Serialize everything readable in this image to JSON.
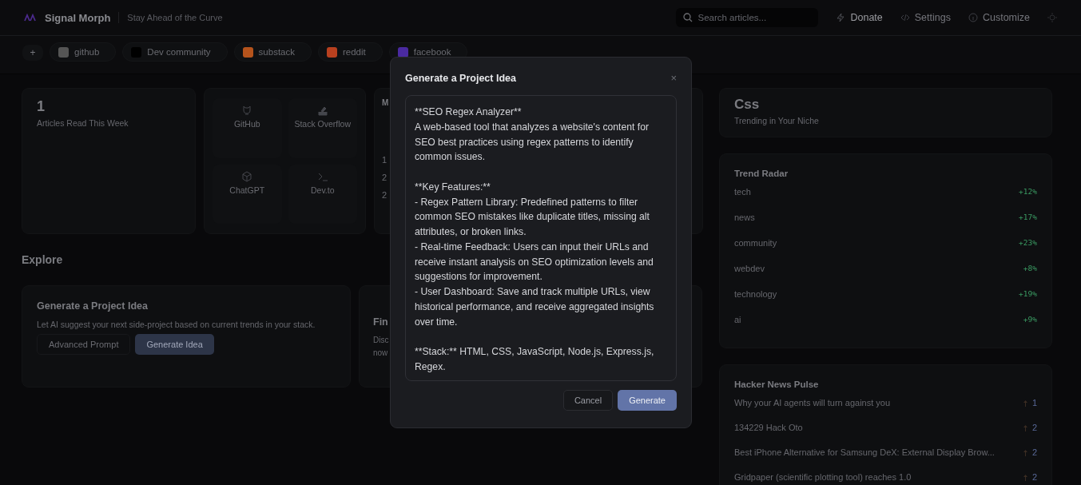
{
  "header": {
    "title": "Signal Morph",
    "tagline": "Stay Ahead of the Curve",
    "search": {
      "placeholder": "Search articles..."
    },
    "actions": [
      {
        "kind": "donate",
        "label": "Donate"
      },
      {
        "kind": "settings",
        "label": "Settings"
      },
      {
        "kind": "customize",
        "label": "Customize"
      },
      {
        "kind": "theme"
      }
    ]
  },
  "sources": {
    "add": "+",
    "chips": [
      {
        "kind": "github",
        "label": "github"
      },
      {
        "kind": "dev",
        "label": "Dev community"
      },
      {
        "kind": "substack",
        "label": "substack"
      },
      {
        "kind": "reddit",
        "label": "reddit"
      },
      {
        "kind": "facebook",
        "label": "facebook"
      }
    ]
  },
  "stats": {
    "value": "1",
    "label": "Articles Read This Week"
  },
  "quick_links": [
    {
      "kind": "github",
      "label": "GitHub"
    },
    {
      "kind": "stackoverflow",
      "label": "Stack Overflow"
    },
    {
      "kind": "chatgpt",
      "label": "ChatGPT"
    },
    {
      "kind": "devto",
      "label": "Dev.to"
    }
  ],
  "partial_card": {
    "heading": "M",
    "lines": [
      "1",
      "2",
      "2"
    ]
  },
  "explore": {
    "heading": "Explore",
    "cards": [
      {
        "title": "Generate a Project Idea",
        "description": "Let AI suggest your next side-project based on current trends in your stack.",
        "buttons": [
          {
            "label": "Advanced Prompt",
            "primary": false
          },
          {
            "label": "Generate Idea",
            "primary": true
          }
        ]
      },
      {
        "title": "Fin",
        "description": "Disc now"
      }
    ]
  },
  "niche": {
    "title": "Css",
    "subtitle": "Trending in Your Niche"
  },
  "trend_radar": {
    "title": "Trend Radar",
    "items": [
      {
        "name": "tech",
        "change": "+12%"
      },
      {
        "name": "news",
        "change": "+17%"
      },
      {
        "name": "community",
        "change": "+23%"
      },
      {
        "name": "webdev",
        "change": "+8%"
      },
      {
        "name": "technology",
        "change": "+19%"
      },
      {
        "name": "ai",
        "change": "+9%"
      }
    ]
  },
  "hacker_news": {
    "title": "Hacker News Pulse",
    "items": [
      {
        "title": "Why your AI agents will turn against you",
        "score": "1"
      },
      {
        "title": "134229 Hack Oto",
        "score": "2"
      },
      {
        "title": "Best iPhone Alternative for Samsung DeX: External Display Brow...",
        "score": "2"
      },
      {
        "title": "Gridpaper (scientific plotting tool) reaches 1.0",
        "score": "2"
      }
    ]
  },
  "modal": {
    "title": "Generate a Project Idea",
    "close": "×",
    "text": "**SEO Regex Analyzer**\nA web-based tool that analyzes a website's content for SEO best practices using regex patterns to identify common issues.\n\n**Key Features:**\n- Regex Pattern Library: Predefined patterns to filter common SEO mistakes like duplicate titles, missing alt attributes, or broken links.\n- Real-time Feedback: Users can input their URLs and receive instant analysis on SEO optimization levels and suggestions for improvement.\n- User Dashboard: Save and track multiple URLs, view historical performance, and receive aggregated insights over time.\n\n**Stack:** HTML, CSS, JavaScript, Node.js, Express.js, Regex.",
    "buttons": [
      {
        "label": "Cancel",
        "primary": false
      },
      {
        "label": "Generate",
        "primary": true
      }
    ]
  }
}
